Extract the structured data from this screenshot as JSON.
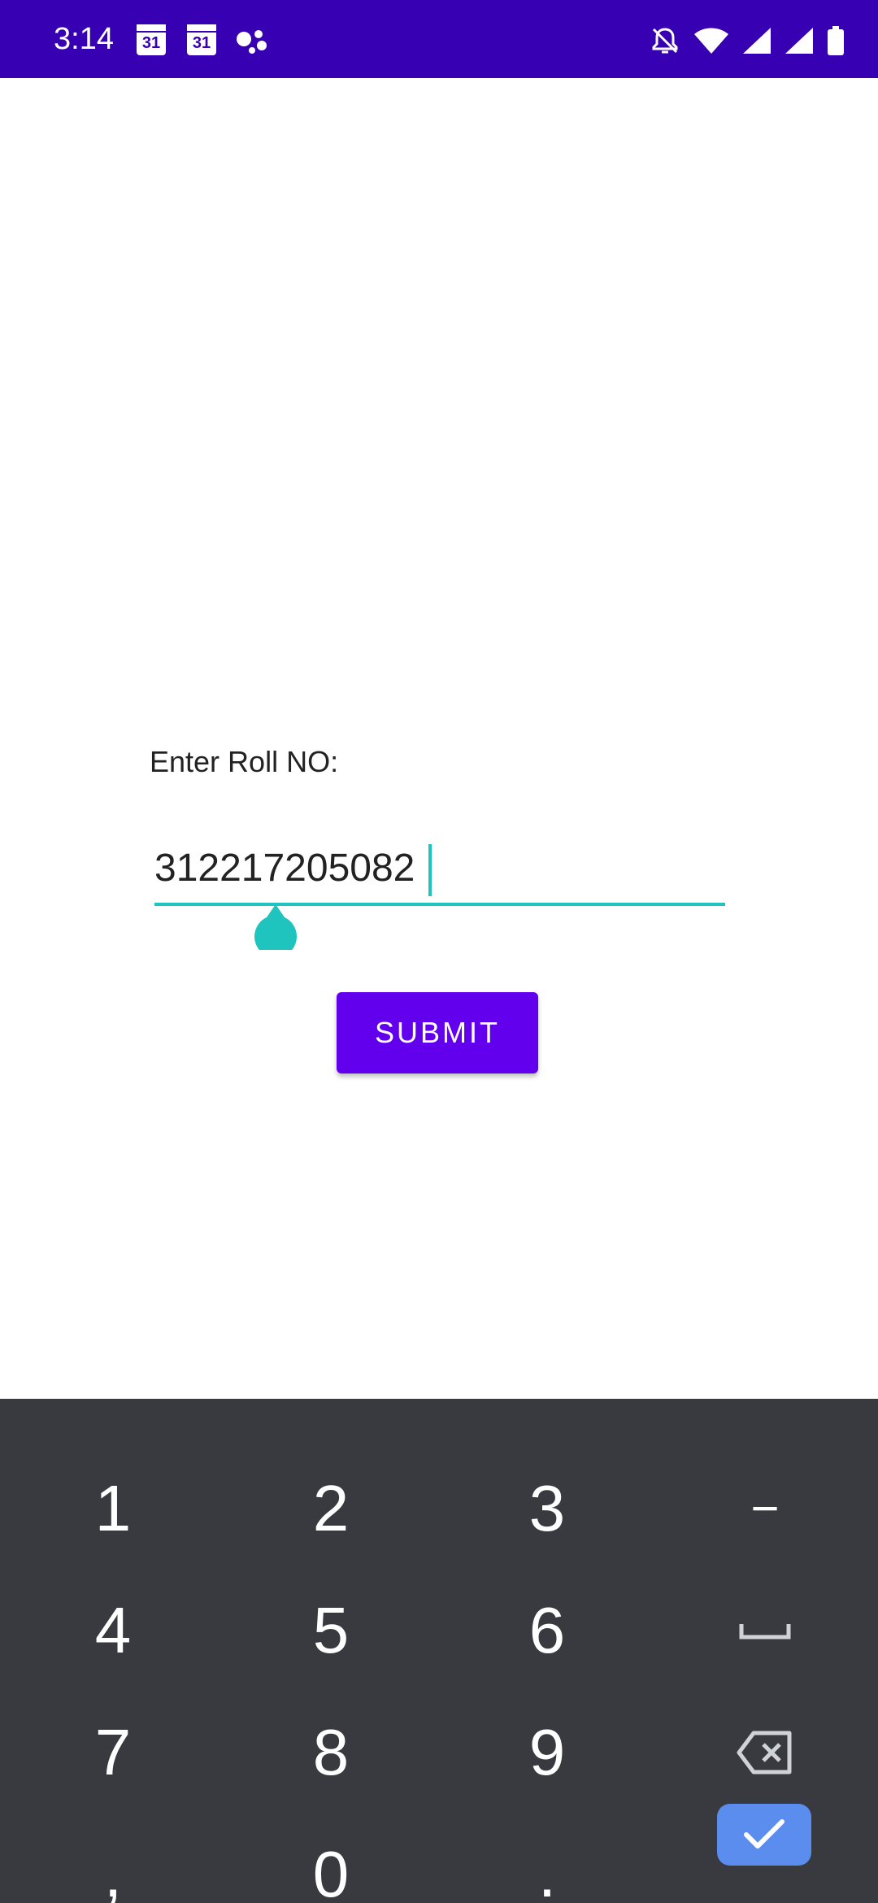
{
  "status_bar": {
    "time": "3:14",
    "calendar_day_1": "31",
    "calendar_day_2": "31",
    "icons": [
      "calendar-icon",
      "calendar-icon",
      "assistant-icon",
      "bell-off-icon",
      "wifi-icon",
      "signal-icon",
      "signal-icon",
      "battery-icon"
    ]
  },
  "form": {
    "label": "Enter Roll NO:",
    "roll_input_value": "312217205082",
    "submit_label": "SUBMIT"
  },
  "keyboard": {
    "keys": [
      {
        "label": "1"
      },
      {
        "label": "2"
      },
      {
        "label": "3"
      },
      {
        "label": "−"
      },
      {
        "label": "4"
      },
      {
        "label": "5"
      },
      {
        "label": "6"
      },
      {
        "label": "␣"
      },
      {
        "label": "7"
      },
      {
        "label": "8"
      },
      {
        "label": "9"
      },
      {
        "label": ""
      },
      {
        "label": ","
      },
      {
        "label": "0"
      },
      {
        "label": "."
      },
      {
        "label": ""
      }
    ]
  },
  "colors": {
    "status_bar": "#3700b3",
    "accent": "#1fc4bf",
    "button": "#6200ee",
    "keyboard_bg": "#383a3f",
    "done_key": "#5b8def"
  }
}
